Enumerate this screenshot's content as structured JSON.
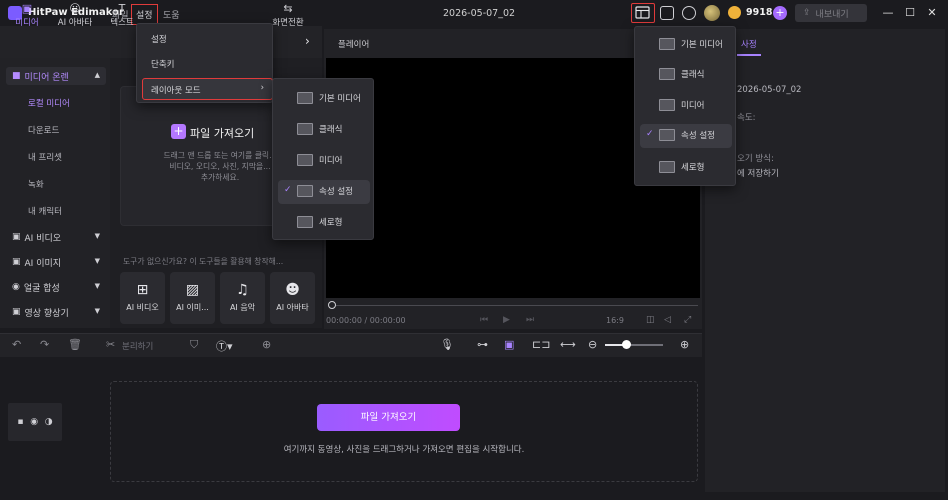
{
  "app": {
    "title": "HitPaw Edimakor",
    "project_title": "2026-05-07_02",
    "coin_count": "9918",
    "export_label": "내보내기"
  },
  "menu": {
    "file": "파일",
    "settings": "설정",
    "help": "도움"
  },
  "tabs": [
    {
      "label": "미디어",
      "active": true
    },
    {
      "label": "AI 아바타"
    },
    {
      "label": "텍스트"
    },
    {
      "label": "화면전환"
    }
  ],
  "sidebar": {
    "media_group": "미디어 온렌",
    "items": [
      "로컬 미디어",
      "다운로드",
      "내 프리셋",
      "녹화",
      "내 캐릭터"
    ],
    "groups": [
      "AI 비디오",
      "AI 이미지",
      "얼굴 합성",
      "영상 향상기"
    ]
  },
  "media": {
    "import_title": "파일 가져오기",
    "import_desc_1": "드래그 앤 드롭 또는 여기를 클릭...",
    "import_desc_2": "비디오, 오디오, 사진, 지막을...",
    "import_desc_3": "추가하세요.",
    "tool_hint": "도구가 없으신가요? 이 도구들을 활용해 창작해...",
    "tools": [
      "AI 비디오",
      "AI 이미...",
      "AI 음악",
      "AI 아바타"
    ]
  },
  "player": {
    "header": "플레이어",
    "time": "00:00:00 / 00:00:00",
    "ratio": "16:9"
  },
  "props": {
    "tab": "사정",
    "project_name": "2026-05-07_02",
    "line_speed": "속도:",
    "line_method": "오기 방식:",
    "line_save": "에 저장하기"
  },
  "timeline_toolbar": {
    "split": "분리하기"
  },
  "timeline": {
    "import_button": "파일 가져오기",
    "drop_hint": "여기까지 동영상, 사진을 드래그하거나 가져오면 편집을 시작합니다."
  },
  "settings_menu": {
    "items": [
      "설정",
      "단축키",
      "레이아웃 모드"
    ]
  },
  "layout_modes": {
    "items": [
      "기본 미디어",
      "클래식",
      "미디어",
      "속성 설정",
      "세로형"
    ],
    "selected_index": 3
  },
  "colors": {
    "accent": "#a883ff",
    "highlight": "#e03b3b",
    "import_gradient_start": "#9a5cff",
    "import_gradient_end": "#c04cff"
  }
}
